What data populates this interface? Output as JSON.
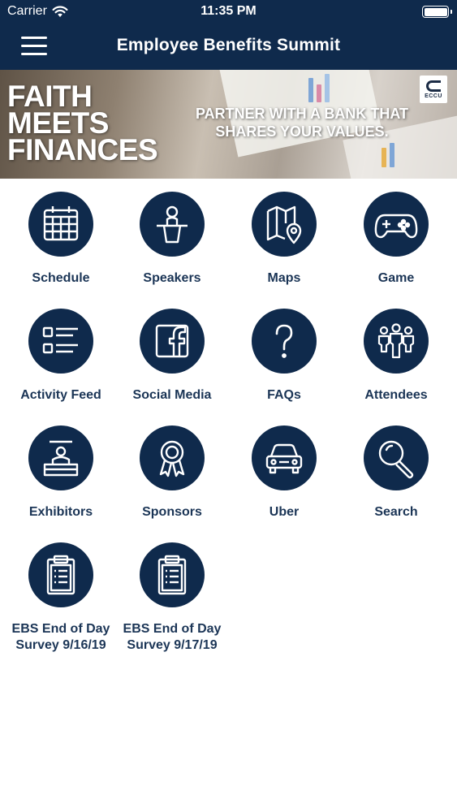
{
  "status_bar": {
    "carrier": "Carrier",
    "time": "11:35 PM",
    "icons": [
      "wifi-icon",
      "battery-icon"
    ]
  },
  "nav": {
    "title": "Employee Benefits Summit",
    "menu_icon": "hamburger-menu-icon"
  },
  "banner": {
    "headline_line1": "FAITH",
    "headline_line2": "MEETS",
    "headline_line3": "FINANCES",
    "tagline_line1": "PARTNER WITH A BANK THAT",
    "tagline_line2": "SHARES YOUR VALUES.",
    "logo_text": "ECCU"
  },
  "colors": {
    "brand": "#0f2a4c",
    "label": "#1b3556",
    "background": "#ffffff"
  },
  "tiles": [
    {
      "label": "Schedule",
      "icon": "calendar-icon"
    },
    {
      "label": "Speakers",
      "icon": "podium-speaker-icon"
    },
    {
      "label": "Maps",
      "icon": "map-pin-icon"
    },
    {
      "label": "Game",
      "icon": "gamepad-icon"
    },
    {
      "label": "Activity Feed",
      "icon": "list-icon"
    },
    {
      "label": "Social Media",
      "icon": "facebook-icon"
    },
    {
      "label": "FAQs",
      "icon": "question-mark-icon"
    },
    {
      "label": "Attendees",
      "icon": "people-group-icon"
    },
    {
      "label": "Exhibitors",
      "icon": "exhibitor-booth-icon"
    },
    {
      "label": "Sponsors",
      "icon": "award-ribbon-icon"
    },
    {
      "label": "Uber",
      "icon": "car-icon"
    },
    {
      "label": "Search",
      "icon": "magnifier-icon"
    },
    {
      "label_line1": "EBS End of Day",
      "label_line2": "Survey 9/16/19",
      "icon": "clipboard-icon"
    },
    {
      "label_line1": "EBS End of Day",
      "label_line2": "Survey 9/17/19",
      "icon": "clipboard-icon"
    }
  ]
}
